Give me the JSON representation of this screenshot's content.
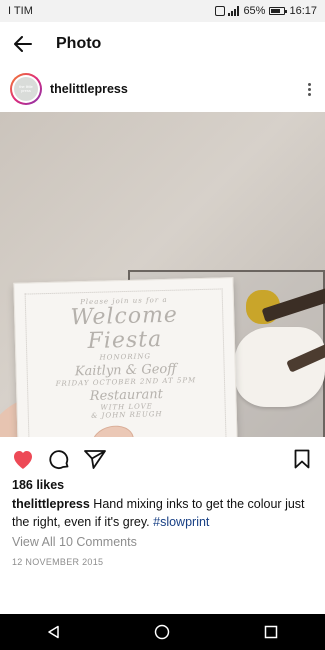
{
  "status_bar": {
    "carrier": "I TIM",
    "battery": "65%",
    "time": "16:17"
  },
  "app_bar": {
    "title": "Photo",
    "back_icon": "arrow-left-icon"
  },
  "post": {
    "username": "thelittlepress",
    "avatar_text": "the little press",
    "more_icon": "more-vertical-icon",
    "image": {
      "card_text": {
        "line1": "Please join us for a",
        "line2": "Welcome",
        "line3": "Fiesta",
        "line4": "HONORING",
        "line5": "Kaitlyn & Geoff",
        "line6": "FRIDAY OCTOBER 2ND AT 5PM",
        "line7": "Restaurant",
        "line8": "WITH LOVE",
        "line9": "& JOHN REUGH"
      }
    },
    "actions": {
      "like_icon": "heart-icon",
      "comment_icon": "comment-icon",
      "share_icon": "send-icon",
      "save_icon": "bookmark-icon",
      "like_color": "#ed4956"
    },
    "likes": "186 likes",
    "caption": {
      "user": "thelittlepress",
      "text": "Hand mixing inks to get the colour just the right, even if it's grey.",
      "hashtag": "#slowprint"
    },
    "view_comments": "View All 10 Comments",
    "date": "12 NOVEMBER 2015"
  },
  "nav_bar": {
    "back": "triangle-back-icon",
    "home": "circle-home-icon",
    "recents": "square-recents-icon"
  }
}
